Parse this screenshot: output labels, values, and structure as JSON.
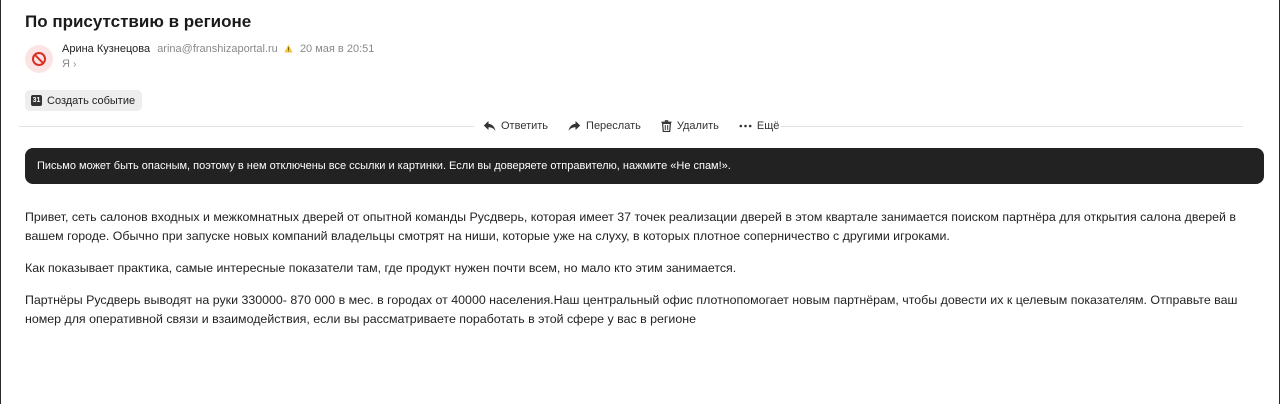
{
  "email": {
    "subject": "По присутствию в регионе",
    "sender": {
      "name": "Арина Кузнецова",
      "email": "arina@franshizaportal.ru",
      "date": "20 мая в 20:51",
      "recipient": "Я"
    },
    "create_event_label": "Создать событие",
    "calendar_icon_text": "31",
    "toolbar": {
      "reply": "Ответить",
      "forward": "Переслать",
      "delete": "Удалить",
      "more": "Ещё"
    },
    "warning_banner": "Письмо может быть опасным, поэтому в нем отключены все ссылки и картинки. Если вы доверяете отправителю, нажмите «Не спам!».",
    "body": [
      "Привет, сеть салонов входных и межкомнатных дверей от опытной команды Русдверь, которая имеет 37 точек реализации дверей в этом квартале занимается поиском партнёра для открытия салона дверей в вашем городе. Обычно при запуске новых компаний владельцы смотрят на ниши, которые уже на слуху, в которых плотное соперничество с другими игроками.",
      "Как показывает практика, самые интересные показатели там, где продукт нужен почти всем, но мало кто этим занимается.",
      "Партнёры Русдверь выводят на руки 330000- 870 000 в мес. в городах от 40000 населения.Наш центральный офис плотнопомогает новым партнёрам, чтобы довести их к целевым показателям. Отправьте ваш номер для оперативной связи и взаимодействия, если вы рассматриваете поработать в этой сфере у вас в регионе"
    ]
  },
  "icons": {
    "avatar": "blocked-icon",
    "warning": "warning-icon",
    "reply": "reply-arrow-icon",
    "forward": "forward-arrow-icon",
    "delete": "trash-icon",
    "more": "dots-icon"
  },
  "colors": {
    "avatar_bg": "#fde4e4",
    "avatar_icon": "#d93025",
    "warning": "#f5c542",
    "banner_bg": "#222222"
  }
}
